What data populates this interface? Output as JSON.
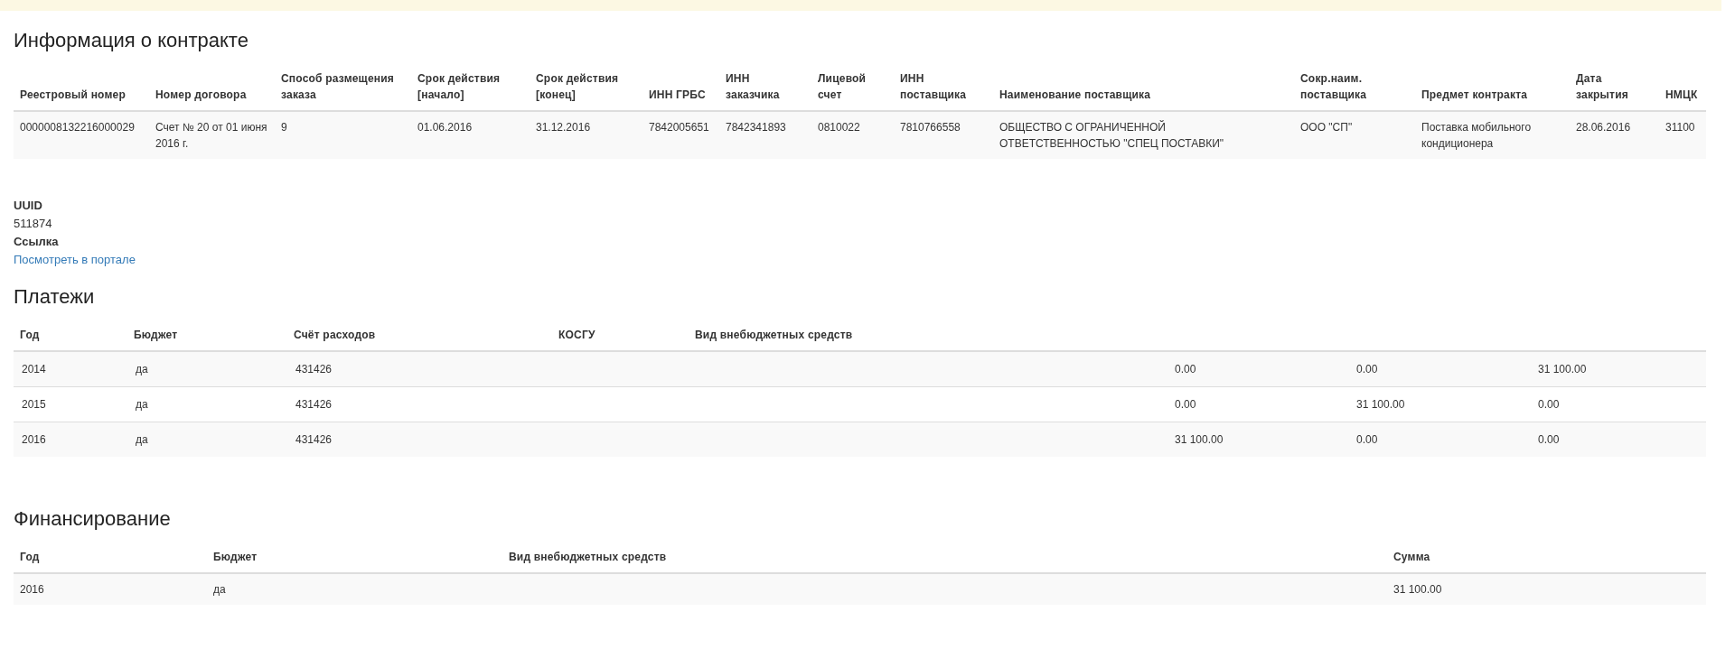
{
  "contract": {
    "title": "Информация о контракте",
    "columns": [
      "Реестровый номер",
      "Номер договора",
      "Способ размещения заказа",
      "Срок действия [начало]",
      "Срок действия [конец]",
      "ИНН ГРБС",
      "ИНН заказчика",
      "Лицевой счет",
      "ИНН поставщика",
      "Наименование поставщика",
      "Сокр.наим. поставщика",
      "Предмет контракта",
      "Дата закрытия",
      "НМЦК"
    ],
    "rows": [
      [
        "0000008132216000029",
        "Счет № 20 от 01 июня 2016 г.",
        "9",
        "01.06.2016",
        "31.12.2016",
        "7842005651",
        "7842341893",
        "0810022",
        "7810766558",
        "ОБЩЕСТВО С ОГРАНИЧЕННОЙ ОТВЕТСТВЕННОСТЬЮ \"СПЕЦ ПОСТАВКИ\"",
        "ООО \"СП\"",
        "Поставка мобильного кондиционера",
        "28.06.2016",
        "31100"
      ]
    ]
  },
  "details": [
    {
      "label": "UUID",
      "value": "511874",
      "kind": "text"
    },
    {
      "label": "Ссылка",
      "value": "Посмотреть в портале",
      "kind": "link"
    }
  ],
  "payments": {
    "title": "Платежи",
    "columns": [
      "Год",
      "Бюджет",
      "Счёт расходов",
      "КОСГУ",
      "Вид внебюджетных средств",
      "",
      "",
      ""
    ],
    "rows": [
      [
        "2014",
        "да",
        "431426",
        "",
        "",
        "0.00",
        "0.00",
        "31 100.00"
      ],
      [
        "2015",
        "да",
        "431426",
        "",
        "",
        "0.00",
        "31 100.00",
        "0.00"
      ],
      [
        "2016",
        "да",
        "431426",
        "",
        "",
        "31 100.00",
        "0.00",
        "0.00"
      ]
    ]
  },
  "financing": {
    "title": "Финансирование",
    "columns": [
      "Год",
      "Бюджет",
      "Вид внебюджетных средств",
      "Сумма"
    ],
    "rows": [
      [
        "2016",
        "да",
        "",
        "31 100.00"
      ]
    ]
  }
}
